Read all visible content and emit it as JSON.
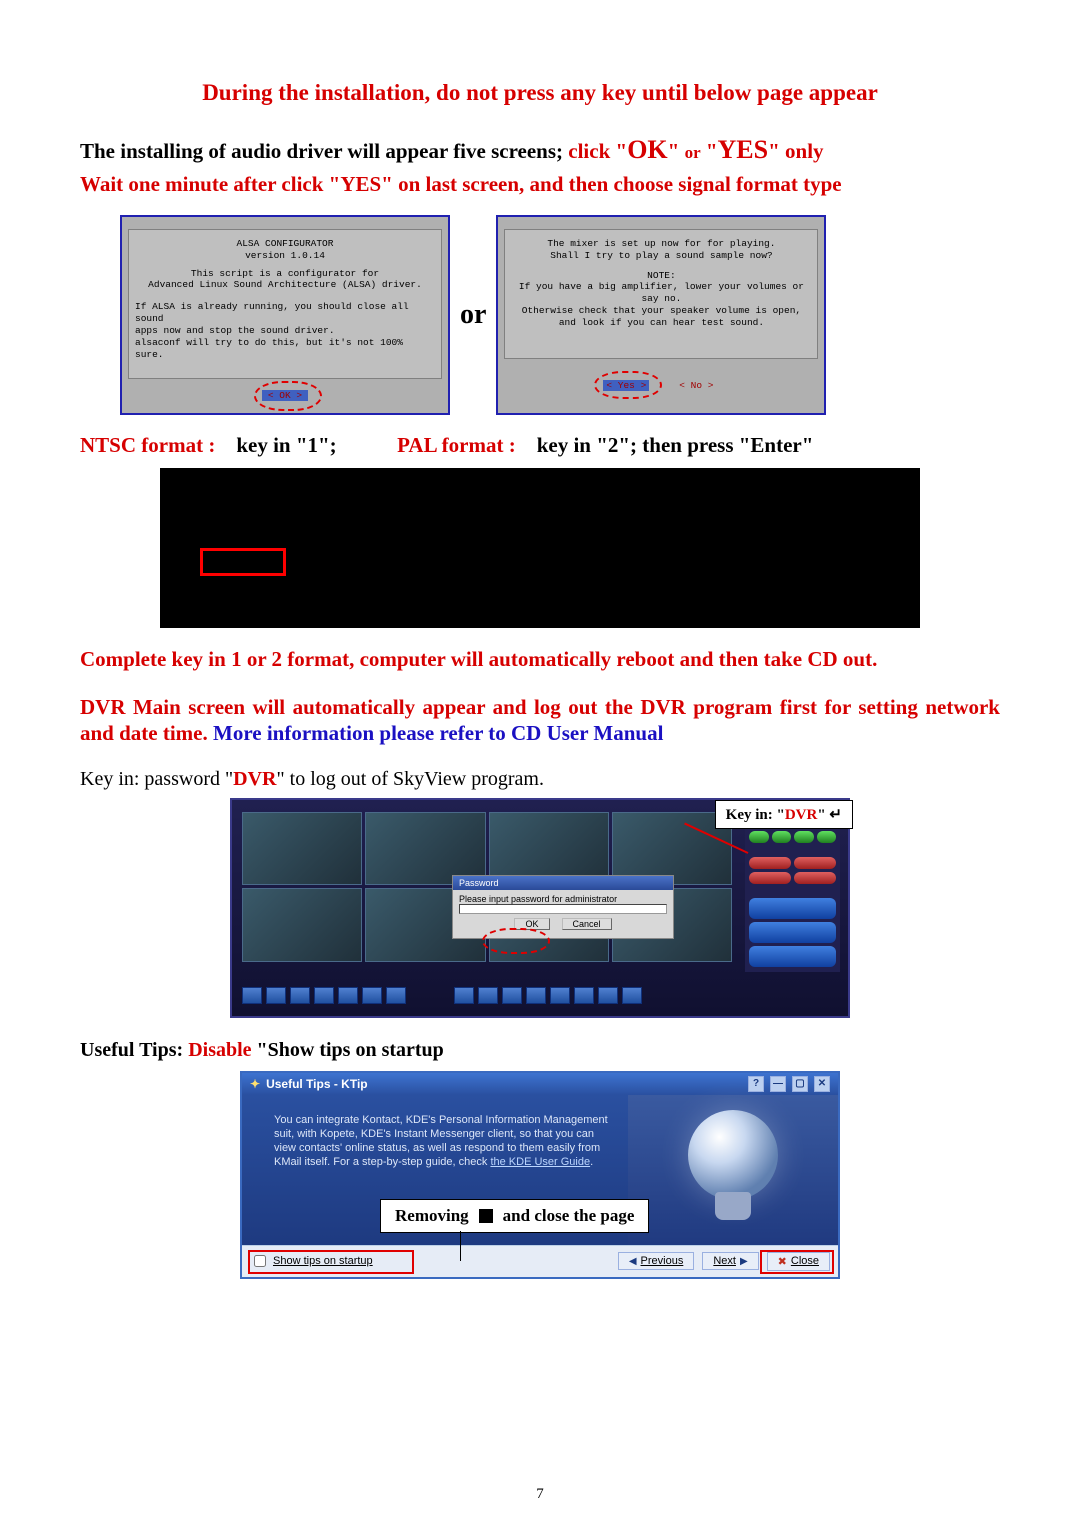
{
  "headline": "During the installation, do not press any key until below page appear",
  "line2": {
    "prefix": "The installing of audio driver will appear five screens; ",
    "click": "click",
    "ok": "OK",
    "or": "or",
    "yes": "YES",
    "suffix": "only"
  },
  "line3": "Wait one minute after click \"YES\" on last screen, and then choose signal format type",
  "alsa1": {
    "title": "ALSA  CONFIGURATOR",
    "version": "version 1.0.14",
    "l1": "This script is a configurator for",
    "l2": "Advanced Linux Sound Architecture (ALSA) driver.",
    "l3": "If ALSA is already running, you should close all sound",
    "l4": "apps now and stop the sound driver.",
    "l5": "alsaconf will try to do this, but it's not 100% sure.",
    "ok": "<  OK  >"
  },
  "or_label": "or",
  "alsa2": {
    "l1": "The mixer is set up now for for playing.",
    "l2": "Shall I try to play a sound sample now?",
    "note": "NOTE:",
    "l3": "If you have a big amplifier, lower your volumes or say no.",
    "l4": "Otherwise check that your speaker volume is open,",
    "l5": "and look if you can hear test sound.",
    "yes": "< Yes >",
    "no": "<  No  >"
  },
  "format_line": {
    "ntsc_label": "NTSC format :",
    "ntsc_val": "key in \"1\";",
    "pal_label": "PAL format :",
    "pal_val": "key in \"2\"; then press \"Enter\""
  },
  "after_term": "Complete key in 1 or 2 format, computer will automatically reboot and then take CD out.",
  "dvr_para": {
    "part1": "DVR Main screen will automatically appear and log out the DVR program first for setting network and date time. ",
    "part2": "More information please refer to CD User Manual"
  },
  "keyin_line": {
    "prefix": "Key in: password \"",
    "dvr": "DVR",
    "suffix": "\" to log out of SkyView program."
  },
  "dvr_callout": {
    "prefix": "Key in: \"",
    "dvr": "DVR",
    "suffix": "\"   ↵"
  },
  "dvr_pw": {
    "title": "Password",
    "body": "Please input password for administrator",
    "ok": "OK",
    "cancel": "Cancel"
  },
  "tips_line": {
    "prefix": "Useful Tips: ",
    "disable": "Disable",
    "suffix": " \"Show tips on startup"
  },
  "ktip": {
    "title": "Useful Tips - KTip",
    "body": "You can integrate Kontact, KDE's Personal Information Management suit, with Kopete, KDE's Instant Messenger client, so that you can view contacts' online status, as well as respond to them easily from KMail itself. For a step-by-step guide, check ",
    "link": "the KDE User Guide",
    "check": "Show tips on startup",
    "prev": "Previous",
    "next": "Next",
    "close": "Close"
  },
  "ktip_callout": {
    "removing": "Removing",
    "rest": "and close the page"
  },
  "page_number": "7"
}
